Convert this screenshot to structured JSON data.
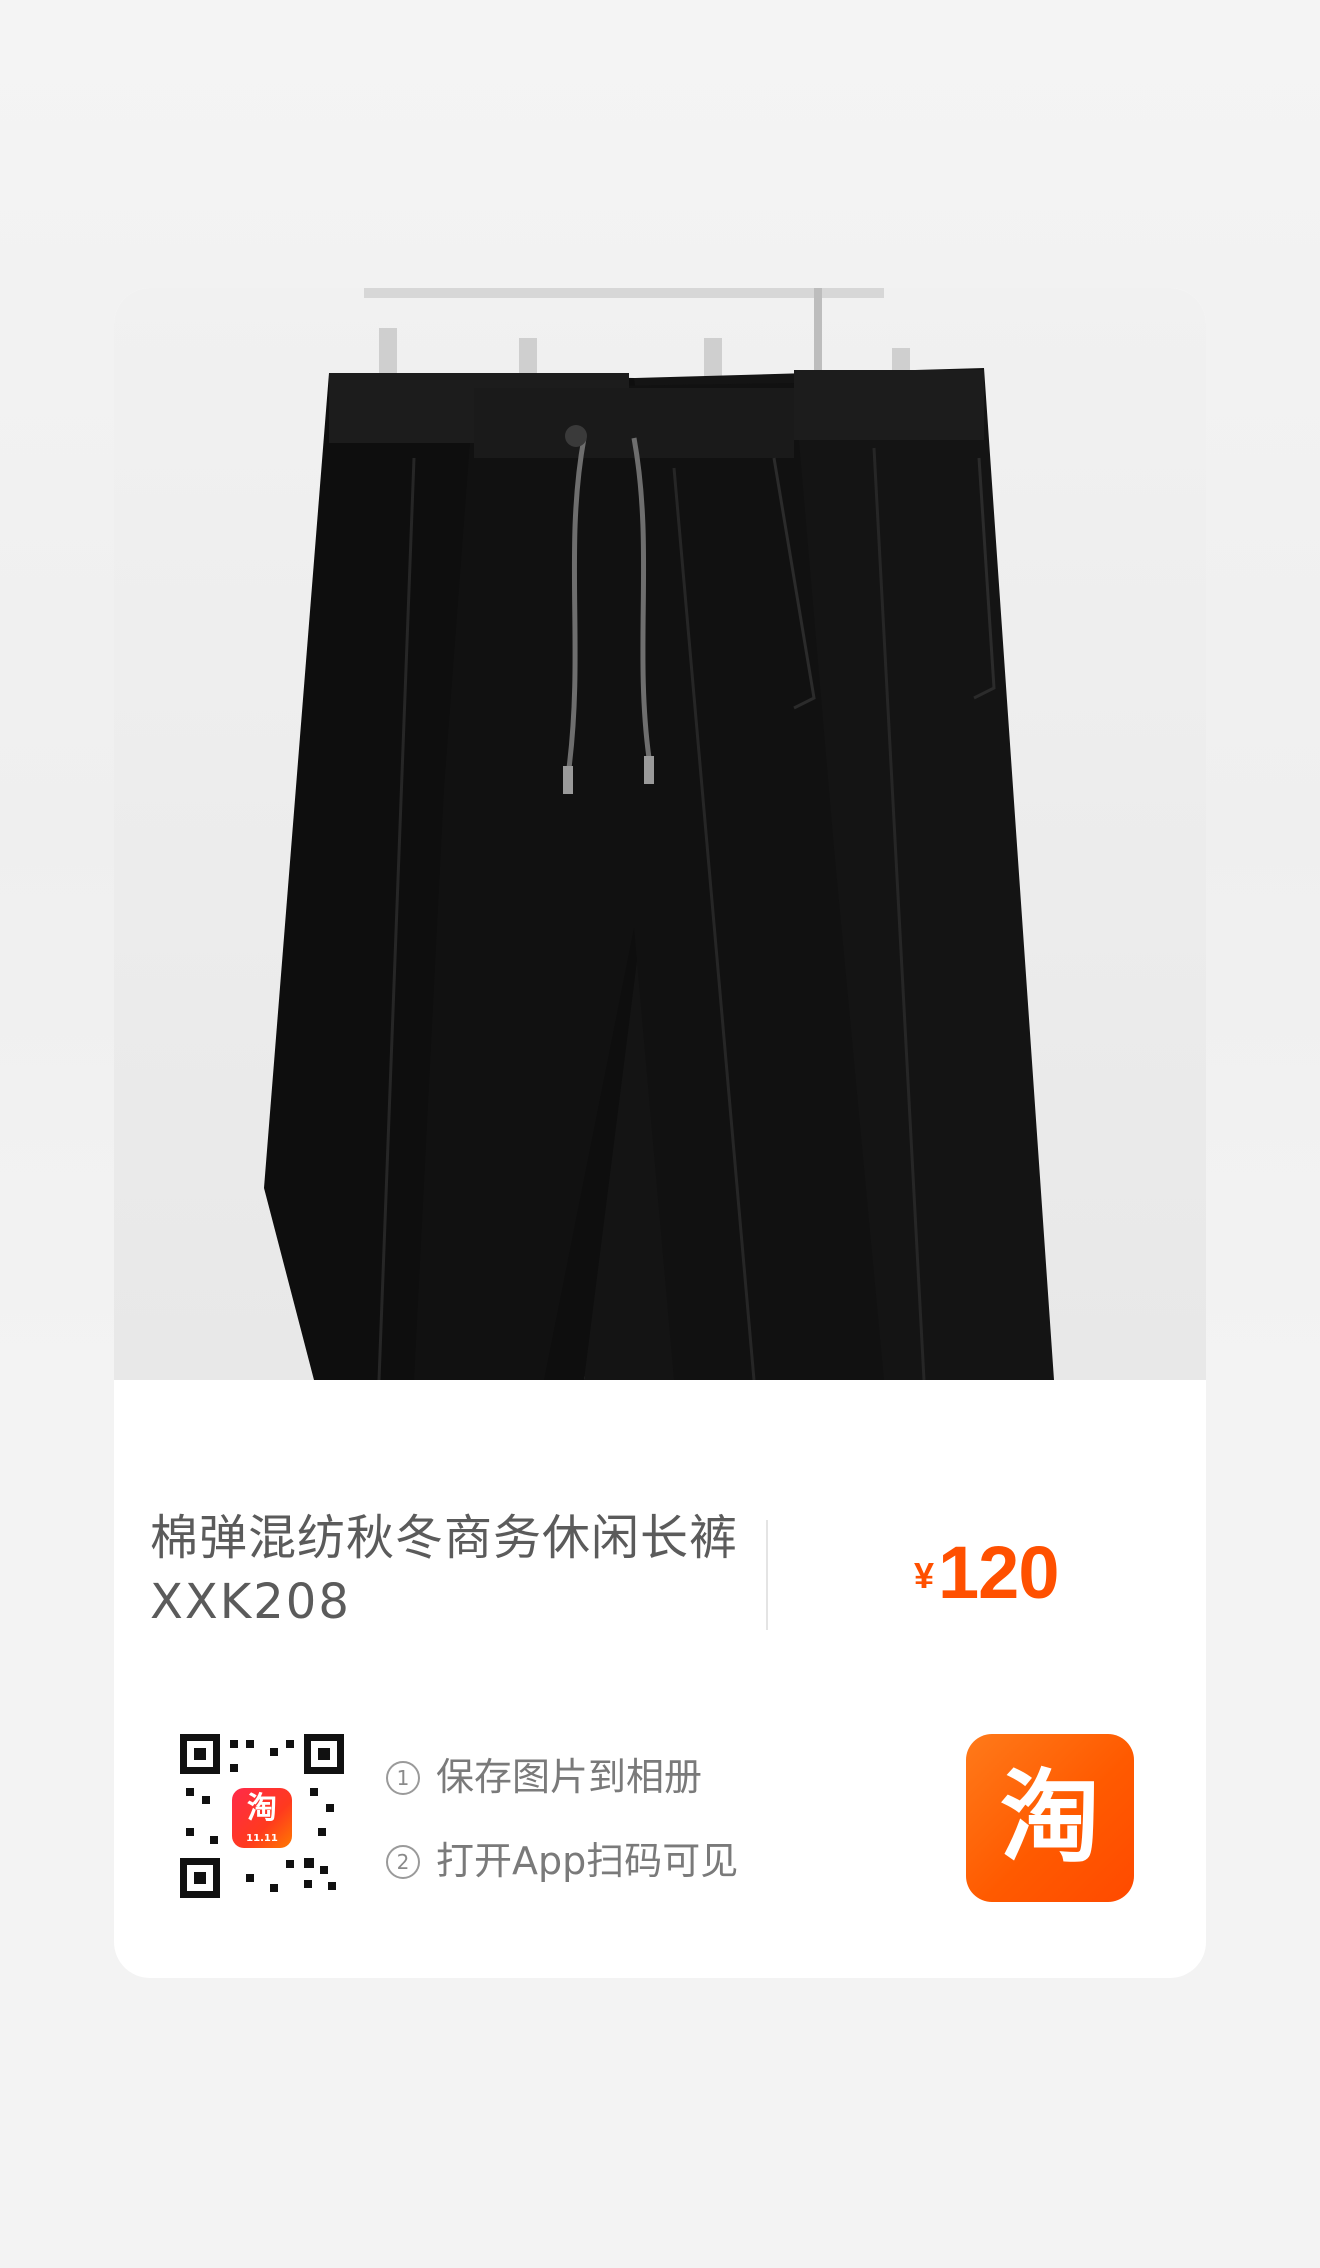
{
  "product": {
    "title_line1": "棉弹混纺秋冬商务休闲长裤",
    "title_line2": "XXK208",
    "price_symbol": "¥",
    "price": "120"
  },
  "qr": {
    "badge_glyph": "淘",
    "badge_caption": "11.11"
  },
  "steps": [
    {
      "num": "1",
      "text": "保存图片到相册"
    },
    {
      "num": "2",
      "text": "打开App扫码可见"
    }
  ],
  "logo": {
    "glyph": "淘"
  },
  "colors": {
    "accent": "#ff5000",
    "logo_bg": "#ff5a00"
  },
  "icons": {
    "product_image": "black-trousers-on-hangers",
    "qr_code": "qr-code",
    "app": "taobao-logo-icon"
  }
}
